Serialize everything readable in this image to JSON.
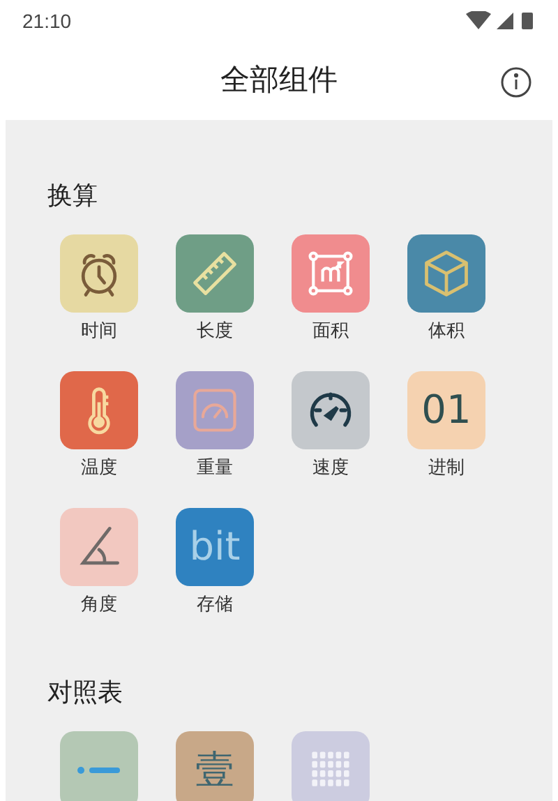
{
  "status_bar": {
    "time": "21:10"
  },
  "header": {
    "title": "全部组件"
  },
  "sections": [
    {
      "title": "换算",
      "items": [
        {
          "label": "时间",
          "kind": "clock",
          "color": "#e6d9a2"
        },
        {
          "label": "长度",
          "kind": "ruler",
          "color": "#6f9e86"
        },
        {
          "label": "面积",
          "kind": "area",
          "color": "#f08c8e"
        },
        {
          "label": "体积",
          "kind": "cube",
          "color": "#4a89a8"
        },
        {
          "label": "温度",
          "kind": "thermometer",
          "color": "#e0684a"
        },
        {
          "label": "重量",
          "kind": "scale",
          "color": "#a5a0c8"
        },
        {
          "label": "速度",
          "kind": "speedometer",
          "color": "#c4c8cc"
        },
        {
          "label": "进制",
          "kind": "glyph",
          "glyph": "01",
          "color": "#f5d2b0"
        },
        {
          "label": "角度",
          "kind": "angle",
          "color": "#f2c8c0"
        },
        {
          "label": "存储",
          "kind": "glyph",
          "glyph": "bit",
          "color": "#2f82c0"
        }
      ]
    },
    {
      "title": "对照表",
      "items": [
        {
          "kind": "dash",
          "color": "#b4c8b4"
        },
        {
          "kind": "glyph",
          "glyph": "壹",
          "color": "#c8a888"
        },
        {
          "kind": "grid",
          "color": "#cccce0"
        }
      ]
    }
  ]
}
